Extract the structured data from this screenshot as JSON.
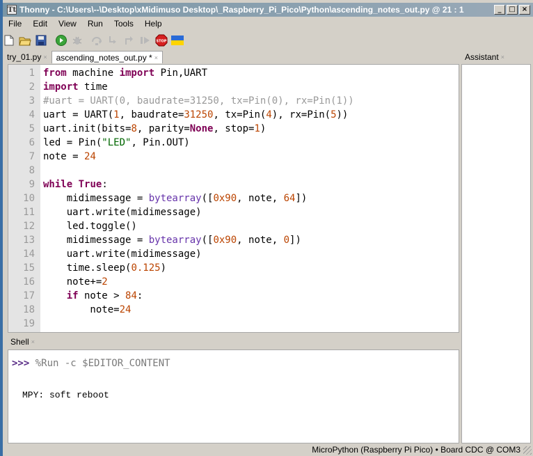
{
  "window": {
    "title": "Thonny  -  C:\\Users\\--\\Desktop\\xMidimuso Desktop\\_Raspberry_Pi_Pico\\Python\\ascending_notes_out.py  @  21 : 1",
    "app_icon": "thonny-icon",
    "controls": [
      "_",
      "□",
      "×"
    ]
  },
  "menu": [
    "File",
    "Edit",
    "View",
    "Run",
    "Tools",
    "Help"
  ],
  "toolbar": {
    "icons": [
      "new-file-icon",
      "open-file-icon",
      "save-icon",
      "run-icon",
      "debug-icon",
      "step-over-icon",
      "step-into-icon",
      "step-out-icon",
      "resume-icon",
      "stop-icon",
      "ukraine-flag-icon"
    ],
    "stop_label": "STOP"
  },
  "editor": {
    "tabs": [
      {
        "label": "try_01.py",
        "close": "×",
        "active": false
      },
      {
        "label": "ascending_notes_out.py *",
        "close": "×",
        "active": true
      }
    ],
    "line_numbers": [
      "1",
      "2",
      "3",
      "4",
      "5",
      "6",
      "7",
      "8",
      "9",
      "10",
      "11",
      "12",
      "13",
      "14",
      "15",
      "16",
      "17",
      "18",
      "19"
    ],
    "lines": [
      [
        {
          "t": "from",
          "c": "kw"
        },
        {
          "t": " machine ",
          "c": ""
        },
        {
          "t": "import",
          "c": "kw"
        },
        {
          "t": " Pin,UART",
          "c": ""
        }
      ],
      [
        {
          "t": "import",
          "c": "kw"
        },
        {
          "t": " time",
          "c": ""
        }
      ],
      [
        {
          "t": "#uart = UART(0, baudrate=31250, tx=Pin(0), rx=Pin(1))",
          "c": "cm"
        }
      ],
      [
        {
          "t": "uart = UART(",
          "c": ""
        },
        {
          "t": "1",
          "c": "num"
        },
        {
          "t": ", baudrate=",
          "c": ""
        },
        {
          "t": "31250",
          "c": "num"
        },
        {
          "t": ", tx=Pin(",
          "c": ""
        },
        {
          "t": "4",
          "c": "num"
        },
        {
          "t": "), rx=Pin(",
          "c": ""
        },
        {
          "t": "5",
          "c": "num"
        },
        {
          "t": "))",
          "c": ""
        }
      ],
      [
        {
          "t": "uart.init(bits=",
          "c": ""
        },
        {
          "t": "8",
          "c": "num"
        },
        {
          "t": ", parity=",
          "c": ""
        },
        {
          "t": "None",
          "c": "kw"
        },
        {
          "t": ", stop=",
          "c": ""
        },
        {
          "t": "1",
          "c": "num"
        },
        {
          "t": ")",
          "c": ""
        }
      ],
      [
        {
          "t": "led = Pin(",
          "c": ""
        },
        {
          "t": "\"LED\"",
          "c": "str"
        },
        {
          "t": ", Pin.OUT)",
          "c": ""
        }
      ],
      [
        {
          "t": "note = ",
          "c": ""
        },
        {
          "t": "24",
          "c": "num"
        }
      ],
      [],
      [
        {
          "t": "while",
          "c": "kw"
        },
        {
          "t": " ",
          "c": ""
        },
        {
          "t": "True",
          "c": "kw"
        },
        {
          "t": ":",
          "c": ""
        }
      ],
      [
        {
          "t": "    midimessage = ",
          "c": ""
        },
        {
          "t": "bytearray",
          "c": "blt"
        },
        {
          "t": "([",
          "c": ""
        },
        {
          "t": "0x90",
          "c": "num"
        },
        {
          "t": ", note, ",
          "c": ""
        },
        {
          "t": "64",
          "c": "num"
        },
        {
          "t": "])",
          "c": ""
        }
      ],
      [
        {
          "t": "    uart.write(midimessage)",
          "c": ""
        }
      ],
      [
        {
          "t": "    led.toggle()",
          "c": ""
        }
      ],
      [
        {
          "t": "    midimessage = ",
          "c": ""
        },
        {
          "t": "bytearray",
          "c": "blt"
        },
        {
          "t": "([",
          "c": ""
        },
        {
          "t": "0x90",
          "c": "num"
        },
        {
          "t": ", note, ",
          "c": ""
        },
        {
          "t": "0",
          "c": "num"
        },
        {
          "t": "])",
          "c": ""
        }
      ],
      [
        {
          "t": "    uart.write(midimessage)",
          "c": ""
        }
      ],
      [
        {
          "t": "    time.sleep(",
          "c": ""
        },
        {
          "t": "0.125",
          "c": "num"
        },
        {
          "t": ")",
          "c": ""
        }
      ],
      [
        {
          "t": "    note+=",
          "c": ""
        },
        {
          "t": "2",
          "c": "num"
        }
      ],
      [
        {
          "t": "    ",
          "c": ""
        },
        {
          "t": "if",
          "c": "kw"
        },
        {
          "t": " note > ",
          "c": ""
        },
        {
          "t": "84",
          "c": "num"
        },
        {
          "t": ":",
          "c": ""
        }
      ],
      [
        {
          "t": "        note=",
          "c": ""
        },
        {
          "t": "24",
          "c": "num"
        }
      ],
      []
    ]
  },
  "shell": {
    "tab_label": "Shell",
    "tab_close": "×",
    "prompt": ">>>",
    "command": " %Run -c $EDITOR_CONTENT",
    "output": "MPY: soft reboot"
  },
  "assistant": {
    "tab_label": "Assistant",
    "tab_close": "×"
  },
  "status": {
    "interpreter": "MicroPython (Raspberry Pi Pico)  •  Board CDC @ COM3"
  },
  "colors": {
    "keyword": "#7f0055",
    "number": "#bb4400",
    "string": "#006600",
    "comment": "#999999",
    "builtin": "#6633aa",
    "prompt": "#5a2d87"
  }
}
